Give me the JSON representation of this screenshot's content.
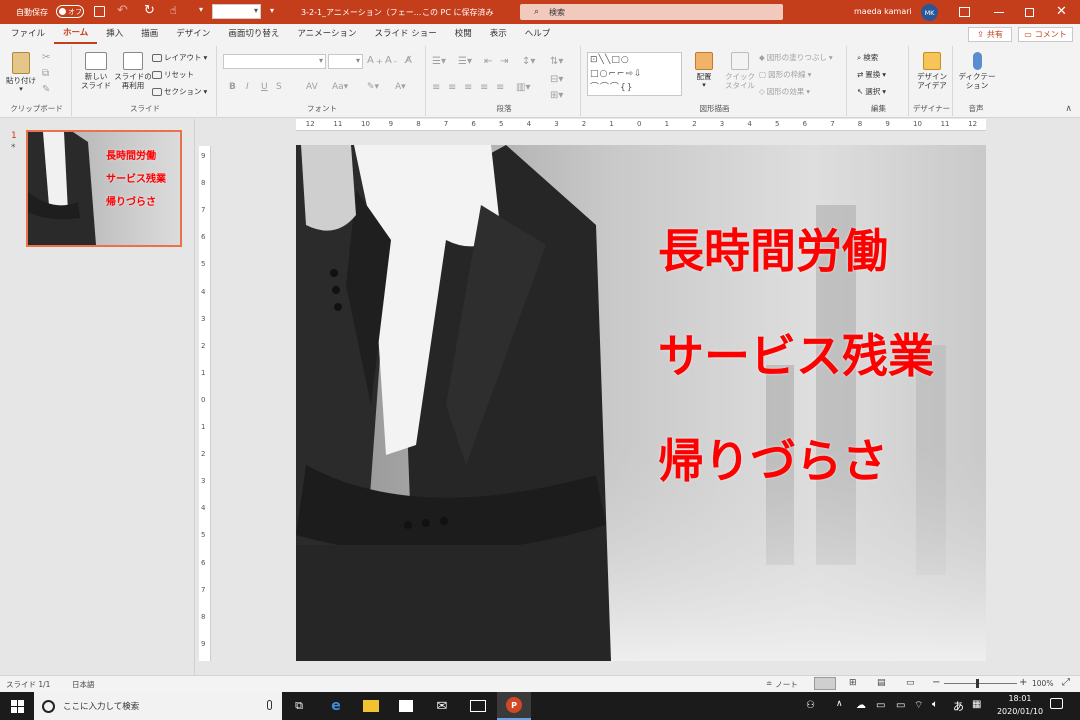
{
  "titlebar": {
    "autosave_label": "自動保存",
    "autosave_toggle": "オフ",
    "filename": "3-2-1_アニメーション（フェー...",
    "save_status": "この PC に保存済み",
    "search_placeholder": "検索",
    "user_name": "maeda kamari",
    "user_initials": "MK"
  },
  "tabs": [
    "ファイル",
    "ホーム",
    "挿入",
    "描画",
    "デザイン",
    "画面切り替え",
    "アニメーション",
    "スライド ショー",
    "校閲",
    "表示",
    "ヘルプ"
  ],
  "share_label": "共有",
  "comment_label": "コメント",
  "ribbon": {
    "clipboard": {
      "paste": "貼り付け",
      "label": "クリップボード"
    },
    "slides": {
      "new_slide": "新しい\nスライド",
      "reuse": "スライドの\n再利用",
      "layout": "レイアウト",
      "reset": "リセット",
      "section": "セクション",
      "label": "スライド"
    },
    "font": {
      "label": "フォント"
    },
    "paragraph": {
      "label": "段落"
    },
    "drawing": {
      "arrange": "配置",
      "quick_styles": "クイック\nスタイル",
      "fill": "図形の塗りつぶし",
      "outline": "図形の枠線",
      "effects": "図形の効果",
      "label": "図形描画"
    },
    "editing": {
      "find": "検索",
      "replace": "置換",
      "select": "選択",
      "label": "編集"
    },
    "designer": {
      "design_ideas": "デザイン\nアイデア",
      "label": "デザイナー"
    },
    "voice": {
      "dictate": "ディクテー\nション",
      "label": "音声"
    }
  },
  "slide_panel": {
    "slide_number": "1",
    "star": "*"
  },
  "slide": {
    "lines": [
      "長時間労働",
      "サービス残業",
      "帰りづらさ"
    ],
    "text_color": "#ff0000"
  },
  "ruler_h": [
    "12",
    "11",
    "10",
    "9",
    "8",
    "7",
    "6",
    "5",
    "4",
    "3",
    "2",
    "1",
    "0",
    "1",
    "2",
    "3",
    "4",
    "5",
    "6",
    "7",
    "8",
    "9",
    "10",
    "11",
    "12"
  ],
  "ruler_v": [
    "9",
    "8",
    "7",
    "6",
    "5",
    "4",
    "3",
    "2",
    "1",
    "0",
    "1",
    "2",
    "3",
    "4",
    "5",
    "6",
    "7",
    "8",
    "9"
  ],
  "statusbar": {
    "slide_info": "スライド 1/1",
    "language": "日本語",
    "notes": "ノート",
    "zoom": "100%"
  },
  "taskbar": {
    "search_placeholder": "ここに入力して検索",
    "time": "18:01",
    "date": "2020/01/10",
    "ime": "あ"
  },
  "colors": {
    "accent": "#c43e1c",
    "ribbon_bg": "#f3f3f3",
    "taskbar_bg": "#1b1b1b"
  }
}
